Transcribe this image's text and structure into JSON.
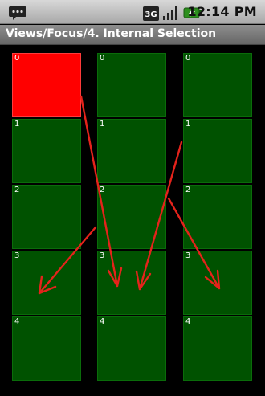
{
  "status_bar": {
    "network_type": "3G",
    "time": "12:14 PM",
    "icons": [
      "notification-icon",
      "3g-icon",
      "signal-strength-icon",
      "battery-charging-icon"
    ]
  },
  "title_bar": {
    "title": "Views/Focus/4. Internal Selection"
  },
  "columns": [
    {
      "cells": [
        "0",
        "1",
        "2",
        "3",
        "4"
      ],
      "focused_index": 0
    },
    {
      "cells": [
        "0",
        "1",
        "2",
        "3",
        "4"
      ],
      "focused_index": null
    },
    {
      "cells": [
        "0",
        "1",
        "2",
        "3",
        "4"
      ],
      "focused_index": null
    }
  ],
  "colors": {
    "focused_cell": "#ff0000",
    "cell": "#005200",
    "arrow": "#e5231b"
  }
}
